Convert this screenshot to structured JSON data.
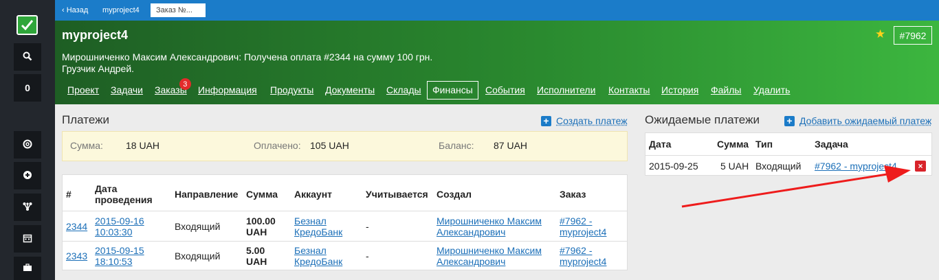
{
  "nav": {
    "back": "‹ Назад",
    "project": "myproject4",
    "current": "Заказ №..."
  },
  "rail": {
    "counter": "0"
  },
  "header": {
    "title": "myproject4",
    "desc1": "Мирошниченко Максим Александрович: Получена оплата #2344 на сумму 100 грн.",
    "desc2": "Грузчик Андрей.",
    "order_id": "#7962",
    "tabs": [
      {
        "label": "Проект"
      },
      {
        "label": "Задачи"
      },
      {
        "label": "Заказы",
        "badge": "3"
      },
      {
        "label": "Информация"
      },
      {
        "label": "Продукты"
      },
      {
        "label": "Документы"
      },
      {
        "label": "Склады"
      },
      {
        "label": "Финансы",
        "active": true
      },
      {
        "label": "События"
      },
      {
        "label": "Исполнители"
      },
      {
        "label": "Контакты"
      },
      {
        "label": "История"
      },
      {
        "label": "Файлы"
      },
      {
        "label": "Удалить"
      }
    ]
  },
  "payments": {
    "title": "Платежи",
    "create_label": "Создать платеж",
    "summary": {
      "sum_label": "Сумма:",
      "sum_value": "18 UAH",
      "paid_label": "Оплачено:",
      "paid_value": "105 UAH",
      "balance_label": "Баланс:",
      "balance_value": "87 UAH"
    },
    "columns": {
      "num": "#",
      "date_1": "Дата",
      "date_2": "проведения",
      "direction": "Направление",
      "amount": "Сумма",
      "account": "Аккаунт",
      "counted": "Учитывается",
      "creator": "Создал",
      "order": "Заказ"
    },
    "rows": [
      {
        "num": "2344",
        "date_1": "2015-09-16",
        "date_2": "10:03:30",
        "direction": "Входящий",
        "amount_1": "100.00",
        "amount_2": "UAH",
        "account_1": "Безнал",
        "account_2": "КредоБанк",
        "counted": "-",
        "creator_1": "Мирошниченко Максим",
        "creator_2": "Александрович",
        "order_1": "#7962 -",
        "order_2": "myproject4"
      },
      {
        "num": "2343",
        "date_1": "2015-09-15",
        "date_2": "18:10:53",
        "direction": "Входящий",
        "amount_1": "5.00",
        "amount_2": "UAH",
        "account_1": "Безнал",
        "account_2": "КредоБанк",
        "counted": "-",
        "creator_1": "Мирошниченко Максим",
        "creator_2": "Александрович",
        "order_1": "#7962 -",
        "order_2": "myproject4"
      }
    ]
  },
  "expected": {
    "title": "Ожидаемые платежи",
    "add_label": "Добавить ожидаемый платеж",
    "columns": {
      "date": "Дата",
      "amount": "Сумма",
      "type": "Тип",
      "task": "Задача"
    },
    "rows": [
      {
        "date": "2015-09-25",
        "amount": "5 UAH",
        "type": "Входящий",
        "task": "#7962 - myproject4",
        "delete": "×"
      }
    ]
  },
  "colors": {
    "topbar": "#1b7cc9",
    "header_dark": "#1e5e24",
    "header_light": "#3cb63f",
    "link": "#1b6fb8",
    "danger": "#d8232a",
    "annotation_arrow": "#ee1c1c"
  },
  "icons": [
    "check-icon",
    "search-icon",
    "lifebuoy-icon",
    "plus-circle-icon",
    "sitemap-icon",
    "calendar-icon",
    "briefcase-icon",
    "star-icon",
    "plus-icon",
    "close-icon"
  ]
}
